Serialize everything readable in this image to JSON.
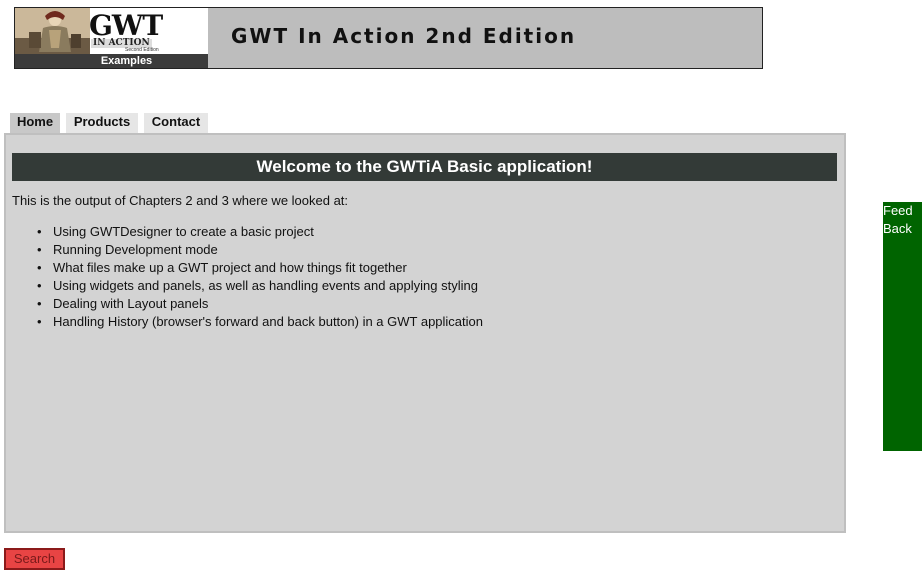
{
  "banner": {
    "logo_title": "GWT",
    "logo_subtitle": "IN ACTION",
    "logo_edition": "Second Edition",
    "logo_caption": "Examples",
    "title": "GWT In Action 2nd Edition"
  },
  "tabs": [
    {
      "label": "Home",
      "selected": true
    },
    {
      "label": "Products",
      "selected": false
    },
    {
      "label": "Contact",
      "selected": false
    }
  ],
  "main": {
    "heading": "Welcome to the GWTiA Basic application!",
    "intro": "This is the output of Chapters 2 and 3 where we looked at:",
    "topics": [
      "Using GWTDesigner to create a basic project",
      "Running Development mode",
      "What files make up a GWT project and how things fit together",
      "Using widgets and panels, as well as handling events and applying styling",
      "Dealing with Layout panels",
      "Handling History (browser's forward and back button) in a GWT application"
    ]
  },
  "feedback": {
    "line1": "Feed",
    "line2": "Back"
  },
  "search": {
    "label": "Search"
  },
  "colors": {
    "banner_bg": "#bdbdbd",
    "panel_bg": "#d3d3d3",
    "heading_bg": "#333a37",
    "feedback_bg": "#006400",
    "search_bg": "#e84444"
  }
}
